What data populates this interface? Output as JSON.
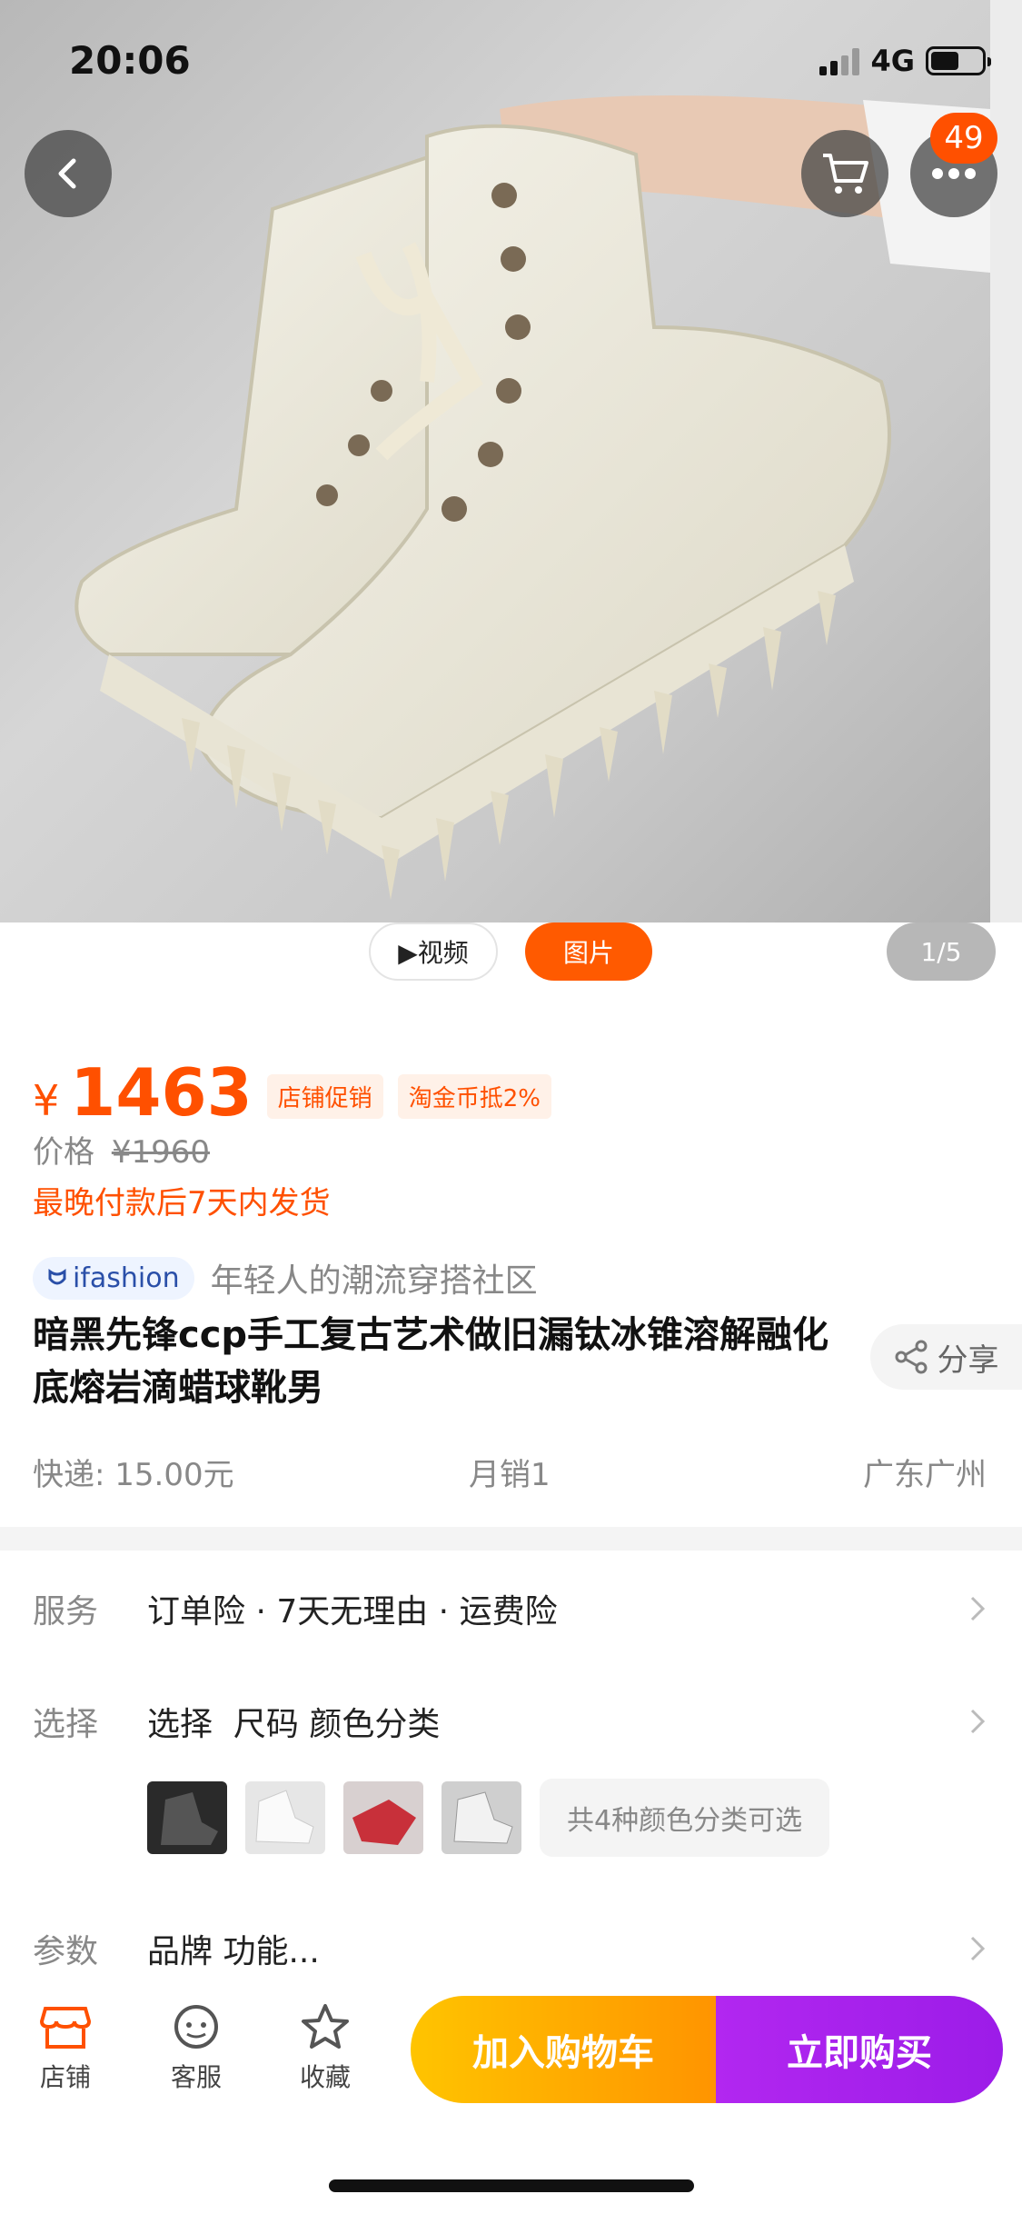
{
  "status_bar": {
    "time": "20:06",
    "network": "4G"
  },
  "top_nav": {
    "cart_badge": "49"
  },
  "media_tabs": {
    "video": "▶视频",
    "pictures": "图片",
    "page_indicator": "1/5"
  },
  "price": {
    "currency": "¥",
    "current": "1463",
    "tags": [
      "店铺促销",
      "淘金币抵2%"
    ],
    "original_label": "价格",
    "original_value": "¥1960",
    "shipping_note": "最晚付款后7天内发货"
  },
  "brand": {
    "logo_text": "ifashion",
    "slogan": "年轻人的潮流穿搭社区"
  },
  "product": {
    "title": "暗黑先锋ccp手工复古艺术做旧漏钛冰锥溶解融化底熔岩滴蜡球靴男",
    "share_label": "分享"
  },
  "meta": {
    "express": "快递: 15.00元",
    "monthly_sales": "月销1",
    "location": "广东广州"
  },
  "rows": {
    "service": {
      "label": "服务",
      "value": "订单险 · 7天无理由 · 运费险"
    },
    "select": {
      "label": "选择",
      "value": "选择  尺码 颜色分类",
      "more": "共4种颜色分类可选"
    },
    "params": {
      "label": "参数",
      "value": "品牌 功能..."
    }
  },
  "bottom_bar": {
    "store": "店铺",
    "service": "客服",
    "favorite": "收藏",
    "add_to_cart": "加入购物车",
    "buy_now": "立即购买"
  },
  "colors": {
    "accent": "#ff5000",
    "cart_btn": "#ffb300",
    "buy_btn": "#a822ec"
  },
  "icons": [
    "back-icon",
    "cart-icon",
    "more-icon",
    "share-icon",
    "store-icon",
    "service-icon",
    "star-icon",
    "chevron-right-icon"
  ]
}
